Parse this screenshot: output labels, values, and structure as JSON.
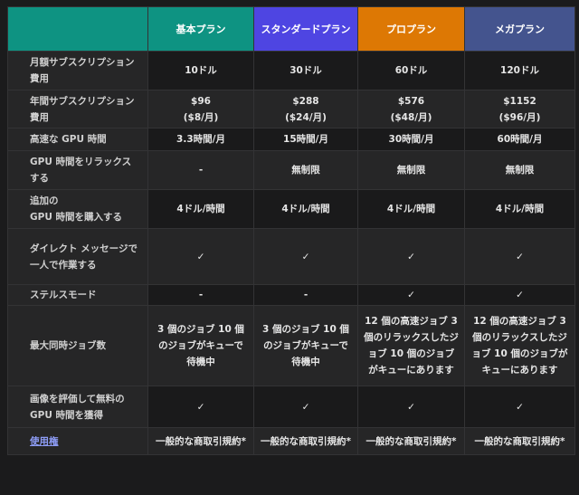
{
  "table": {
    "headers": [
      "",
      "基本プラン",
      "スタンダードプラン",
      "プロプラン",
      "メガプラン"
    ],
    "header_colors": [
      "#0e9382",
      "#0e9382",
      "#4e45e2",
      "#dd7804",
      "#44548e"
    ],
    "rows": [
      {
        "label": "月額サブスクリプション費用",
        "cells": [
          "10ドル",
          "30ドル",
          "60ドル",
          "120ドル"
        ]
      },
      {
        "label": "年間サブスクリプション費用",
        "cells": [
          "$96\n($8/月)",
          "$288\n($24/月)",
          "$576\n($48/月)",
          "$1152\n($96/月)"
        ]
      },
      {
        "label": "高速な GPU 時間",
        "cells": [
          "3.3時間/月",
          "15時間/月",
          "30時間/月",
          "60時間/月"
        ]
      },
      {
        "label": "GPU 時間をリラックスする",
        "cells": [
          "-",
          "無制限",
          "無制限",
          "無制限"
        ]
      },
      {
        "label": "追加の\nGPU 時間を購入する",
        "cells": [
          "4ドル/時間",
          "4ドル/時間",
          "4ドル/時間",
          "4ドル/時間"
        ]
      },
      {
        "label": "ダイレクト メッセージで一人で作業する",
        "cells": [
          "✓",
          "✓",
          "✓",
          "✓"
        ]
      },
      {
        "label": "ステルスモード",
        "cells": [
          "-",
          "-",
          "✓",
          "✓"
        ]
      },
      {
        "label": "最大同時ジョブ数",
        "cells": [
          "3 個のジョブ\n10 個のジョブがキューで待機中",
          "3 個のジョブ\n10 個のジョブがキューで待機中",
          "12 個の高速ジョブ\n3 個のリラックスしたジョブ\n10 個のジョブがキューにあります",
          "12 個の高速ジョブ\n3 個のリラックスしたジョブ\n10 個のジョブがキューにあります"
        ]
      },
      {
        "label": "画像を評価して無料の GPU 時間を獲得",
        "cells": [
          "✓",
          "✓",
          "✓",
          "✓"
        ]
      },
      {
        "label": "使用権",
        "label_is_link": true,
        "cells": [
          "一般的な商取引規約*",
          "一般的な商取引規約*",
          "一般的な商取引規約*",
          "一般的な商取引規約*"
        ]
      }
    ]
  },
  "icons": {
    "check": "check-icon",
    "dash": "dash"
  }
}
